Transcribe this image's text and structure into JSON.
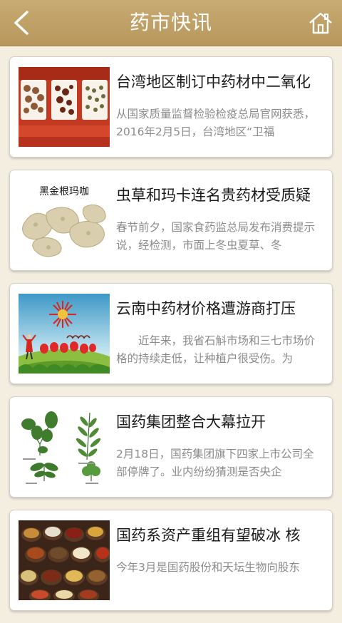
{
  "header": {
    "title": "药市快讯",
    "back_icon": "back-arrow-icon",
    "home_icon": "home-icon"
  },
  "colors": {
    "header_background": "#bfa063",
    "page_background": "#f3eee0",
    "card_background": "#ffffff",
    "title_text": "#1c1c1c",
    "description_text": "#8b8b8b"
  },
  "news": [
    {
      "title": "台湾地区制订中药材中二氧化",
      "description": "从国家质量监督检验检疫总局官网获悉，2016年2月5日，台湾地区“卫福",
      "image": "herbal-slices-photo"
    },
    {
      "title": "虫草和玛卡连名贵药材受质疑",
      "description": "春节前夕，国家食药监总局发布消费提示说，经检测，市面上冬虫夏草、冬",
      "image": "black-maca-photo",
      "image_caption": "黑金根玛咖"
    },
    {
      "title": "云南中药材价格遭游商打压",
      "description": "　　近年来，我省石斛市场和三七市场价格的持续走低，让种植户很受伤。为",
      "image": "herbal-garden-illustration"
    },
    {
      "title": "国药集团整合大幕拉开",
      "description": "2月18日，国药集团旗下四家上市公司全部停牌了。业内纷纷猜测是否央企",
      "image": "herb-botanical-drawing"
    },
    {
      "title": "国药系资产重组有望破冰 核",
      "description": "今年3月是国药股份和天坛生物向股东",
      "image": "spice-bowls-photo"
    }
  ]
}
